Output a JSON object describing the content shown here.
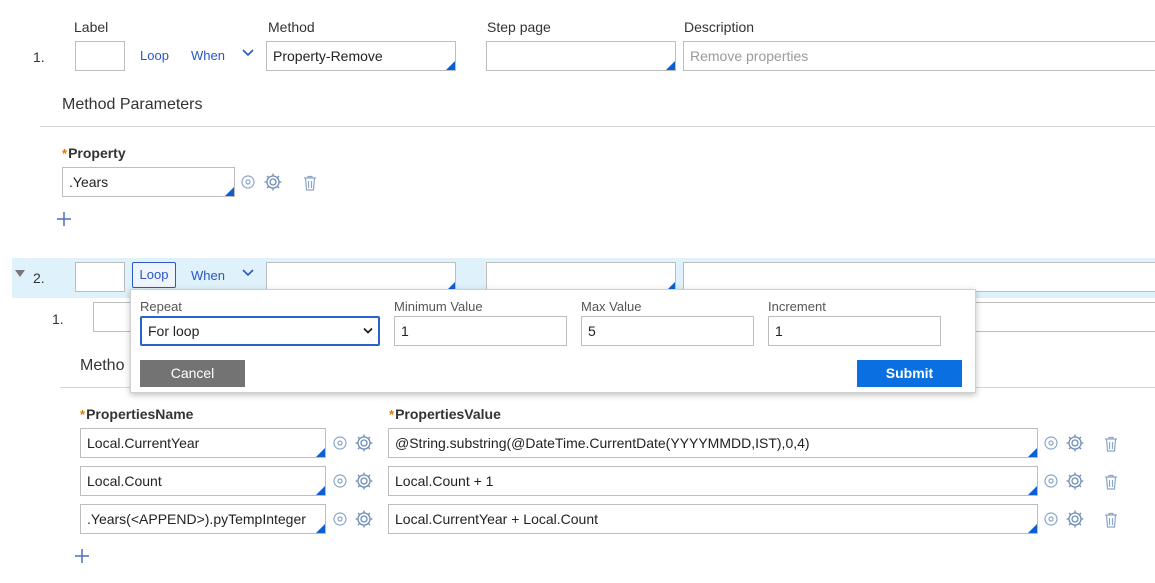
{
  "header": {
    "label": "Label",
    "method": "Method",
    "step_page": "Step page",
    "description": "Description"
  },
  "step1": {
    "number": "1.",
    "loop": "Loop",
    "when": "When",
    "method_value": "Property-Remove",
    "description_placeholder": "Remove properties",
    "params_title": "Method Parameters",
    "property_label": "Property",
    "property_value": ".Years"
  },
  "step2": {
    "number": "2.",
    "loop": "Loop",
    "when": "When",
    "sub_number": "1.",
    "params_title_partial": "Metho",
    "col_name": "PropertiesName",
    "col_value": "PropertiesValue",
    "rows": [
      {
        "name": "Local.CurrentYear",
        "value": "@String.substring(@DateTime.CurrentDate(YYYYMMDD,IST),0,4)"
      },
      {
        "name": "Local.Count",
        "value": "Local.Count + 1"
      },
      {
        "name": ".Years(<APPEND>).pyTempInteger",
        "value": "Local.CurrentYear + Local.Count"
      }
    ]
  },
  "loop_popup": {
    "repeat_label": "Repeat",
    "repeat_value": "For loop",
    "min_label": "Minimum Value",
    "min_value": "1",
    "max_label": "Max Value",
    "max_value": "5",
    "increment_label": "Increment",
    "increment_value": "1",
    "cancel": "Cancel",
    "submit": "Submit"
  },
  "colors": {
    "accent": "#0b5fd6",
    "highlight_row": "#dff1fb",
    "submit": "#0a6fe0",
    "cancel": "#737373",
    "required": "#e07a00"
  }
}
